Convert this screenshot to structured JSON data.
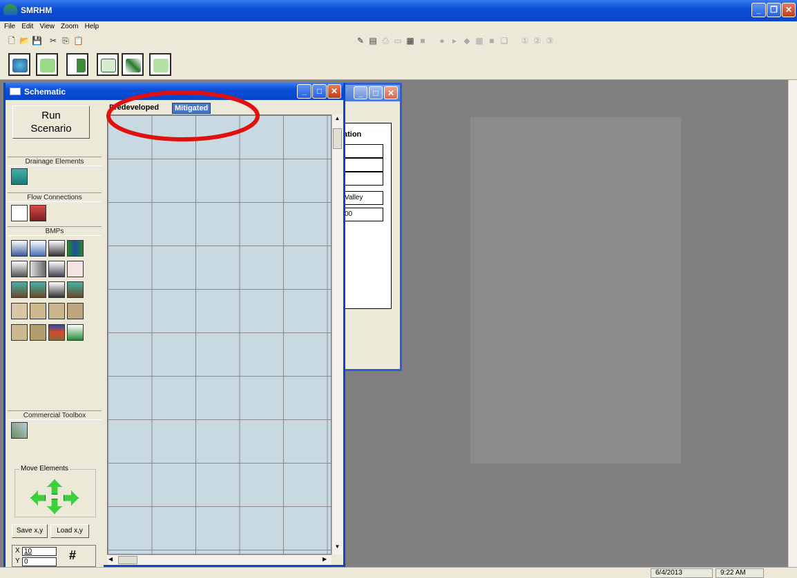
{
  "app": {
    "title": "SMRHM"
  },
  "menu": [
    "File",
    "Edit",
    "View",
    "Zoom",
    "Help"
  ],
  "schematic": {
    "title": "Schematic",
    "run_button": "Run\nScenario",
    "tabs": [
      "Predeveloped",
      "Mitigated"
    ],
    "sections": {
      "drainage": "Drainage Elements",
      "flow": "Flow Connections",
      "bmps": "BMPs",
      "commercial": "Commercial Toolbox",
      "move": "Move Elements"
    },
    "save_xy": "Save x,y",
    "load_xy": "Load x,y",
    "x_label": "X",
    "y_label": "Y",
    "x_value": "10",
    "y_value": "0",
    "grid_symbol": "#"
  },
  "second_window": {
    "heading": "ation",
    "fields": [
      "",
      "",
      "",
      "Valley",
      "00"
    ]
  },
  "statusbar": {
    "date": "6/4/2013",
    "time": "9:22 AM"
  },
  "colors": {
    "titlebar": "#0a4fd6",
    "highlight_circle": "#e01010",
    "canvas": "#c9d9e2"
  }
}
